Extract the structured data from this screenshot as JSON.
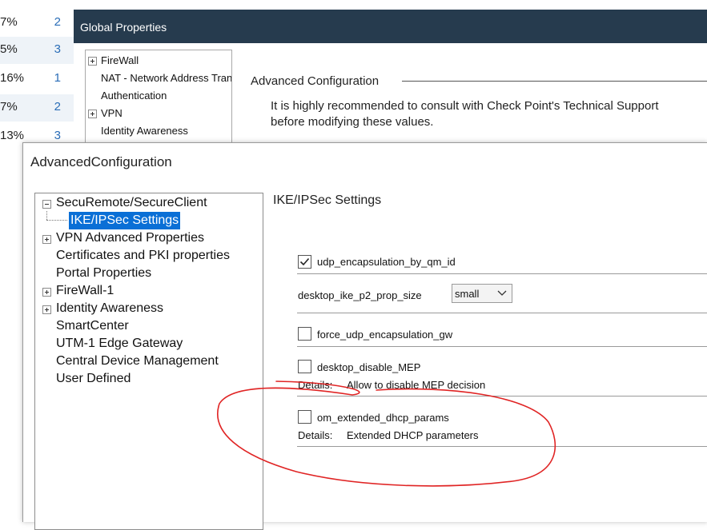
{
  "background_list": [
    {
      "percent": "7%",
      "count": "2"
    },
    {
      "percent": "5%",
      "count": "3"
    },
    {
      "percent": "16%",
      "count": "1"
    },
    {
      "percent": "7%",
      "count": "2"
    },
    {
      "percent": "13%",
      "count": "3"
    }
  ],
  "global_properties": {
    "title": "Global Properties",
    "tree": [
      {
        "label": "FireWall",
        "expandable": true
      },
      {
        "label": "NAT - Network Address Translation",
        "expandable": false
      },
      {
        "label": "Authentication",
        "expandable": false
      },
      {
        "label": "VPN",
        "expandable": true
      },
      {
        "label": "Identity Awareness",
        "expandable": false
      }
    ],
    "section_heading": "Advanced Configuration",
    "note_line1": "It is highly recommended to consult with Check Point's Technical Support",
    "note_line2": "before modifying these values."
  },
  "dialog": {
    "title": "AdvancedConfiguration",
    "tree": [
      {
        "label": "SecuRemote/SecureClient",
        "expanded": true
      },
      {
        "label": "IKE/IPSec Settings",
        "selected": true
      },
      {
        "label": "VPN Advanced Properties",
        "expandable": true
      },
      {
        "label": "Certificates and PKI properties"
      },
      {
        "label": "Portal Properties"
      },
      {
        "label": "FireWall-1",
        "expandable": true
      },
      {
        "label": "Identity Awareness",
        "expandable": true
      },
      {
        "label": "SmartCenter"
      },
      {
        "label": "UTM-1 Edge Gateway"
      },
      {
        "label": "Central Device Management"
      },
      {
        "label": "User Defined"
      }
    ],
    "section_title": "IKE/IPSec Settings",
    "settings": {
      "udp_encapsulation": {
        "label": "udp_encapsulation_by_qm_id",
        "checked": true
      },
      "desktop_ike_p2_prop_size": {
        "label": "desktop_ike_p2_prop_size",
        "value": "small"
      },
      "force_udp": {
        "label": "force_udp_encapsulation_gw",
        "checked": false
      },
      "desktop_disable_mep": {
        "label": "desktop_disable_MEP",
        "checked": false,
        "details_label": "Details:",
        "details": "Allow to disable MEP decision"
      },
      "om_extended_dhcp": {
        "label": "om_extended_dhcp_params",
        "checked": false,
        "details_label": "Details:",
        "details": "Extended DHCP parameters"
      }
    }
  },
  "colors": {
    "title_bar": "#263b4e",
    "selection": "#0a6fd6",
    "annotation": "#e02424",
    "link_blue": "#2a6db7"
  }
}
